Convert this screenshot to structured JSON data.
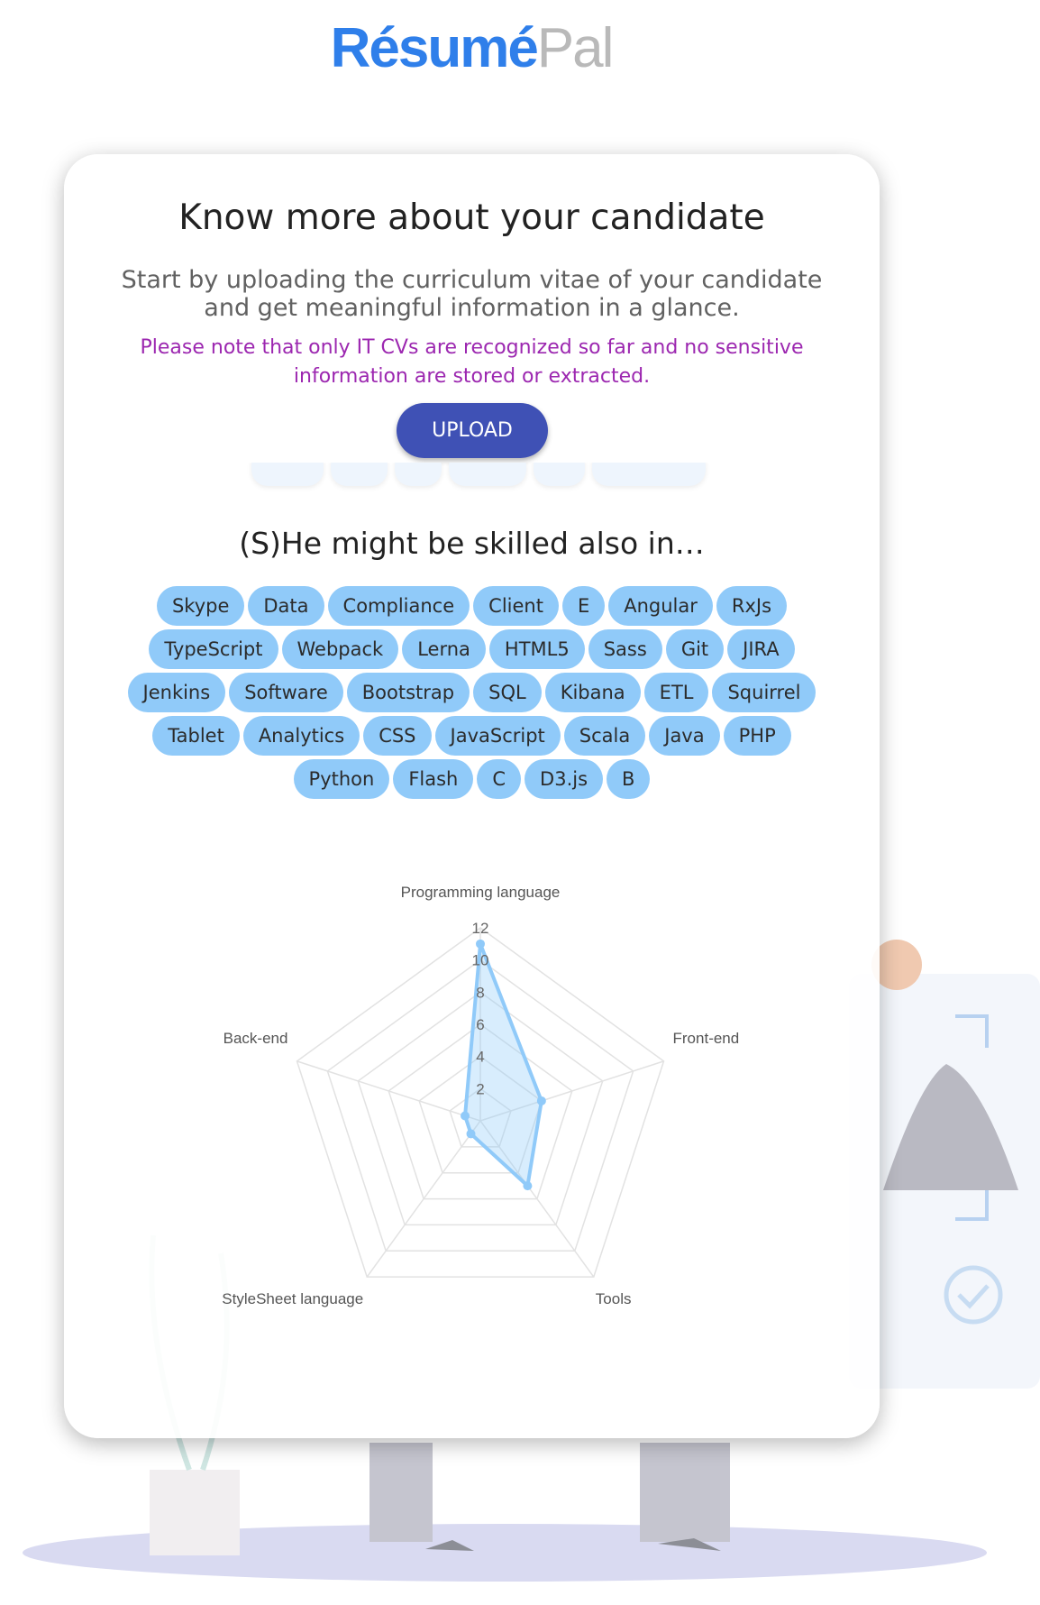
{
  "logo": {
    "part1": "Résumé",
    "part2": "Pal"
  },
  "card": {
    "title": "Know more about your candidate",
    "subtitle": "Start by uploading the curriculum vitae of your candidate and get meaningful information in a glance.",
    "note": "Please note that only IT CVs are recognized so far and no sensitive information are stored or extracted.",
    "upload_label": "UPLOAD"
  },
  "skills_section": {
    "title": "(S)He might be skilled also in…",
    "rows": [
      [
        "Skype",
        "Data",
        "Compliance",
        "Client",
        "E",
        "Angular",
        "RxJs"
      ],
      [
        "TypeScript",
        "Webpack",
        "Lerna",
        "HTML5",
        "Sass",
        "Git",
        "JIRA"
      ],
      [
        "Jenkins",
        "Software",
        "Bootstrap",
        "SQL",
        "Kibana",
        "ETL",
        "Squirrel"
      ],
      [
        "Tablet",
        "Analytics",
        "CSS",
        "JavaScript",
        "Scala",
        "Java",
        "PHP"
      ],
      [
        "Python",
        "Flash",
        "C",
        "D3.js",
        "B"
      ]
    ]
  },
  "chart_data": {
    "type": "radar",
    "categories": [
      "Programming language",
      "Front-end",
      "Tools",
      "StyleSheet language",
      "Back-end"
    ],
    "values": [
      11,
      4,
      5,
      1,
      1
    ],
    "r_ticks": [
      "2",
      "4",
      "6",
      "8",
      "10",
      "12"
    ],
    "rlim": [
      0,
      12
    ],
    "grid": true,
    "legend": "none",
    "color": "#90caf9"
  },
  "colors": {
    "primary_button": "#3f51b5",
    "chip_background": "#90caf9",
    "note_text": "#9c27b0",
    "logo_blue": "#2f7fea",
    "logo_purple": "#9b3fc4"
  }
}
